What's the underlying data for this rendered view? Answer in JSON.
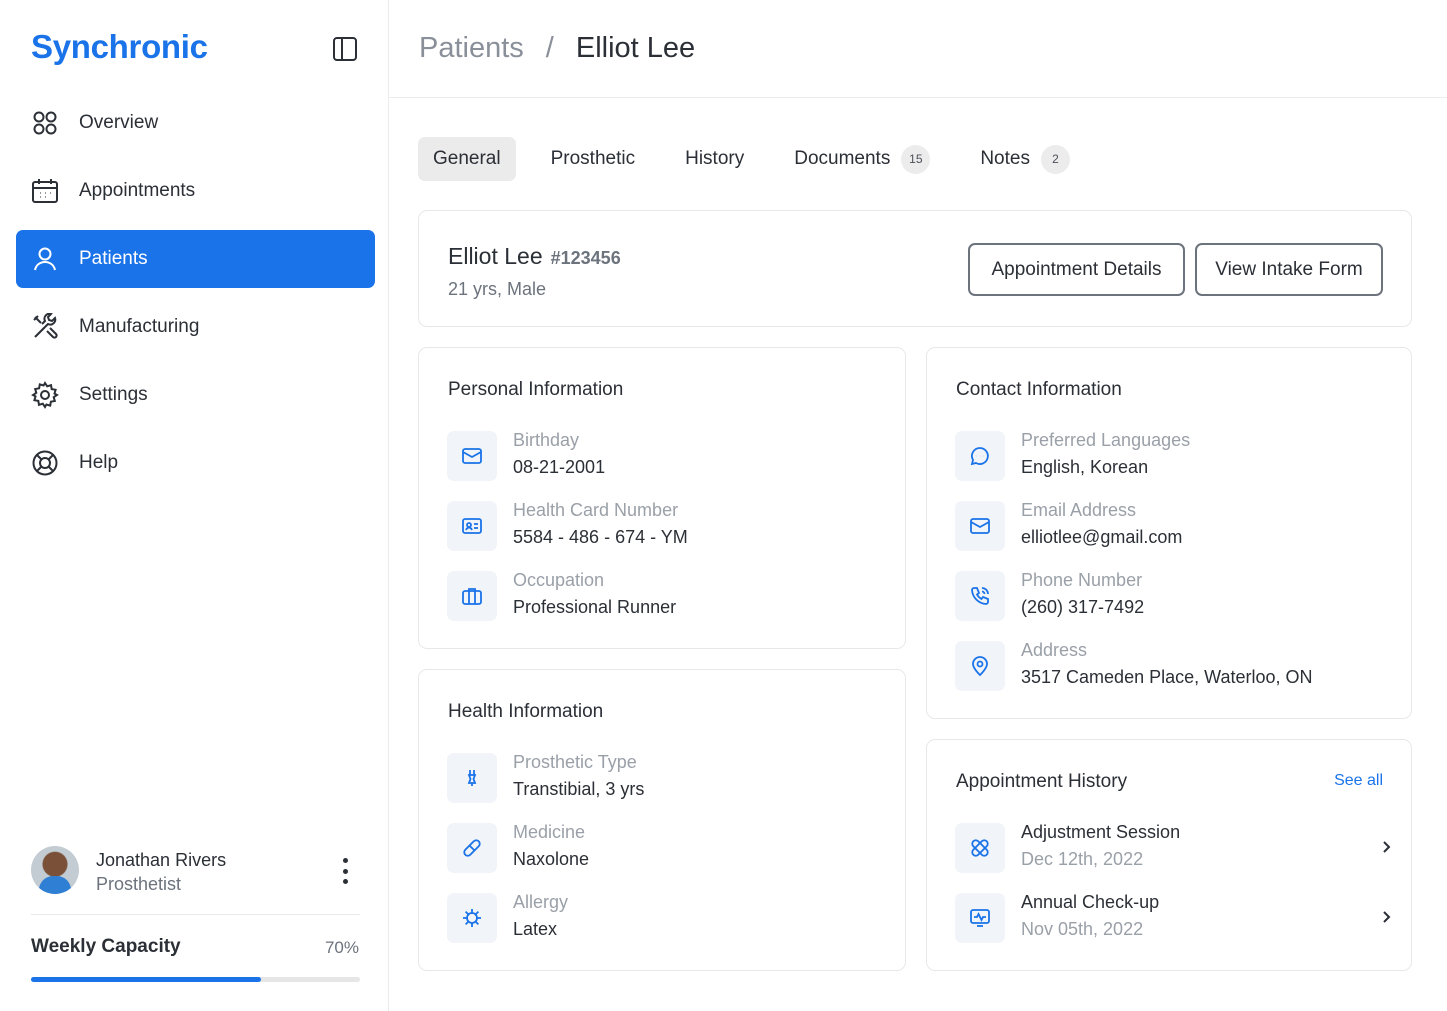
{
  "sidebar": {
    "brand": "Synchronic",
    "nav": [
      {
        "label": "Overview",
        "icon": "grid-icon"
      },
      {
        "label": "Appointments",
        "icon": "calendar-icon"
      },
      {
        "label": "Patients",
        "icon": "user-icon",
        "active": true
      },
      {
        "label": "Manufacturing",
        "icon": "tools-icon"
      },
      {
        "label": "Settings",
        "icon": "gear-icon"
      },
      {
        "label": "Help",
        "icon": "lifebuoy-icon"
      }
    ],
    "user": {
      "name": "Jonathan Rivers",
      "role": "Prosthetist"
    },
    "capacity": {
      "label": "Weekly Capacity",
      "value_text": "70%",
      "fraction": 0.7
    }
  },
  "header": {
    "crumb_parent": "Patients",
    "crumb_separator": "/",
    "crumb_current": "Elliot Lee"
  },
  "tabs": [
    {
      "label": "General",
      "active": true
    },
    {
      "label": "Prosthetic"
    },
    {
      "label": "History"
    },
    {
      "label": "Documents",
      "badge": "15"
    },
    {
      "label": "Notes",
      "badge": "2"
    }
  ],
  "patient": {
    "name": "Elliot Lee",
    "id": "#123456",
    "meta": "21 yrs, Male",
    "buttons": {
      "appointment": "Appointment Details",
      "intake": "View Intake Form"
    }
  },
  "personal": {
    "title": "Personal Information",
    "rows": [
      {
        "label": "Birthday",
        "value": "08-21-2001",
        "icon": "mail-icon"
      },
      {
        "label": "Health Card Number",
        "value": "5584 - 486 - 674 - YM",
        "icon": "id-card-icon"
      },
      {
        "label": "Occupation",
        "value": "Professional Runner",
        "icon": "briefcase-icon"
      }
    ]
  },
  "health": {
    "title": "Health Information",
    "rows": [
      {
        "label": "Prosthetic Type",
        "value": "Transtibial, 3 yrs",
        "icon": "prosthetic-icon"
      },
      {
        "label": "Medicine",
        "value": "Naxolone",
        "icon": "pill-icon"
      },
      {
        "label": "Allergy",
        "value": "Latex",
        "icon": "virus-icon"
      }
    ]
  },
  "contact": {
    "title": "Contact Information",
    "rows": [
      {
        "label": "Preferred Languages",
        "value": "English, Korean",
        "icon": "chat-icon"
      },
      {
        "label": "Email Address",
        "value": "elliotlee@gmail.com",
        "icon": "mail-icon"
      },
      {
        "label": "Phone Number",
        "value": "(260) 317-7492",
        "icon": "phone-icon"
      },
      {
        "label": "Address",
        "value": "3517 Cameden Place, Waterloo, ON",
        "icon": "location-icon"
      }
    ]
  },
  "history": {
    "title": "Appointment History",
    "see_all": "See all",
    "rows": [
      {
        "label": "Adjustment Session",
        "value": "Dec 12th, 2022",
        "icon": "bandage-icon"
      },
      {
        "label": "Annual Check-up",
        "value": "Nov 05th, 2022",
        "icon": "monitor-icon"
      }
    ]
  },
  "colors": {
    "accent": "#1a73e8",
    "text": "#2b2f36",
    "muted": "#9aa0a8"
  }
}
